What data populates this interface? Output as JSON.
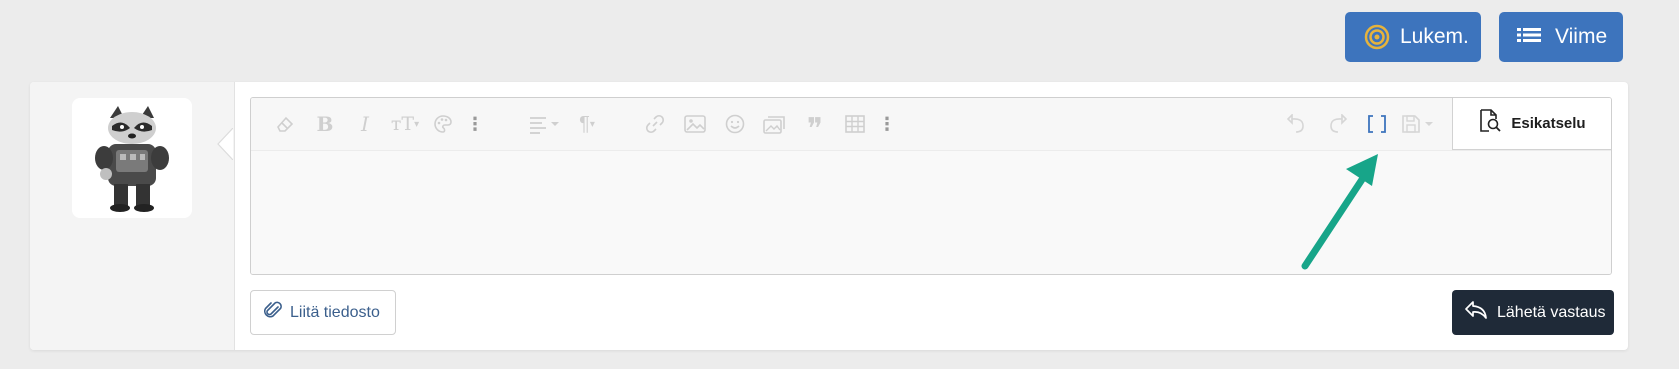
{
  "header": {
    "unread_button": {
      "label": "Lukem.",
      "icon": "target-icon"
    },
    "recent_button": {
      "label": "Viime",
      "icon": "list-icon"
    }
  },
  "editor": {
    "toolbar": {
      "icons": [
        "eraser-icon",
        "bold-icon",
        "italic-icon",
        "text-size-icon",
        "palette-icon",
        "more-vertical-icon",
        "align-icon",
        "paragraph-icon",
        "link-icon",
        "image-icon",
        "smiley-icon",
        "media-icon",
        "quote-icon",
        "table-icon",
        "more-vertical-icon",
        "undo-icon",
        "redo-icon",
        "bbcode-toggle-icon",
        "save-draft-icon"
      ]
    },
    "preview_tab": {
      "label": "Esikatselu",
      "icon": "preview-icon"
    },
    "content": ""
  },
  "footer": {
    "attach_label": "Liitä tiedosto",
    "submit_label": "Lähetä vastaus"
  },
  "colors": {
    "page_bg": "#ececec",
    "primary_button": "#3d74bd",
    "submit_button": "#1f2a38",
    "annotation_arrow": "#17a589",
    "bbcode_icon": "#3d74bd"
  }
}
